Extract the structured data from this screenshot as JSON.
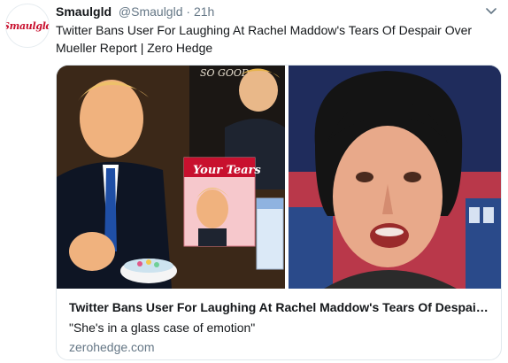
{
  "tweet": {
    "avatar_text": "Smaulgld",
    "display_name": "Smaulgld",
    "handle": "@Smaulgld",
    "separator": "·",
    "time": "21h",
    "text": "Twitter Bans User For Laughing At Rachel Maddow's Tears Of Despair Over Mueller Report | Zero Hedge"
  },
  "card": {
    "image_left_caption": "SO GOOD~",
    "cereal_box_title": "Your Tears",
    "title": "Twitter Bans User For Laughing At Rachel Maddow's Tears Of Despair Over Mueller Report",
    "description": "\"She's in a glass case of emotion\"",
    "domain": "zerohedge.com"
  },
  "colors": {
    "name": "#14171a",
    "secondary": "#657786",
    "border": "#e1e8ed",
    "logo_red": "#c8102e"
  },
  "icons": {
    "menu": "chevron-down-icon"
  }
}
